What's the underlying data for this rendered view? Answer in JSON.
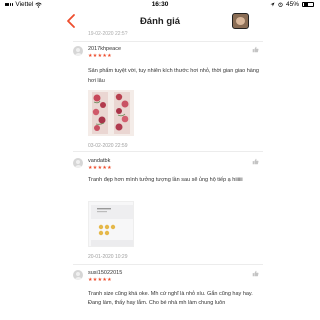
{
  "status_bar": {
    "carrier": "Viettel",
    "time": "16:30",
    "battery_percent": "45%",
    "battery_level": 0.45
  },
  "header": {
    "title": "Đánh giá"
  },
  "clipped_date": "19-02-2020 22:5?",
  "reviews": [
    {
      "username": "2017khpeace",
      "stars": "★★★★★",
      "text": "Sản phẩm tuyệt vời, tuy nhiên kích thước hơi nhỏ, thời gian giao hàng hơi lâu",
      "date": "03-02-2020 22:59"
    },
    {
      "username": "vandatbk",
      "stars": "★★★★★",
      "text": "Tranh đẹp hơn mình tưởng tượng lần sau sẽ ủng hộ tiếp ạ hiiiiii",
      "date": "20-01-2020 10:29"
    },
    {
      "username": "susi15022015",
      "stars": "★★★★★",
      "text": "Tranh size cũng khá oke. Mh cứ nghĩ là nhỏ xíu. Gắn cũng hay hay. Đang làm, thấy hay lắm. Cho bé nhà mh làm chung luôn",
      "date": ""
    }
  ],
  "icons": {
    "back": "chevron-left-icon",
    "like": "thumbs-up-icon",
    "wifi": "wifi-icon",
    "location": "location-icon",
    "alarm": "alarm-icon"
  },
  "colors": {
    "accent": "#ee4d2d",
    "star": "#ee4d2d",
    "muted": "#9e9e9e"
  }
}
